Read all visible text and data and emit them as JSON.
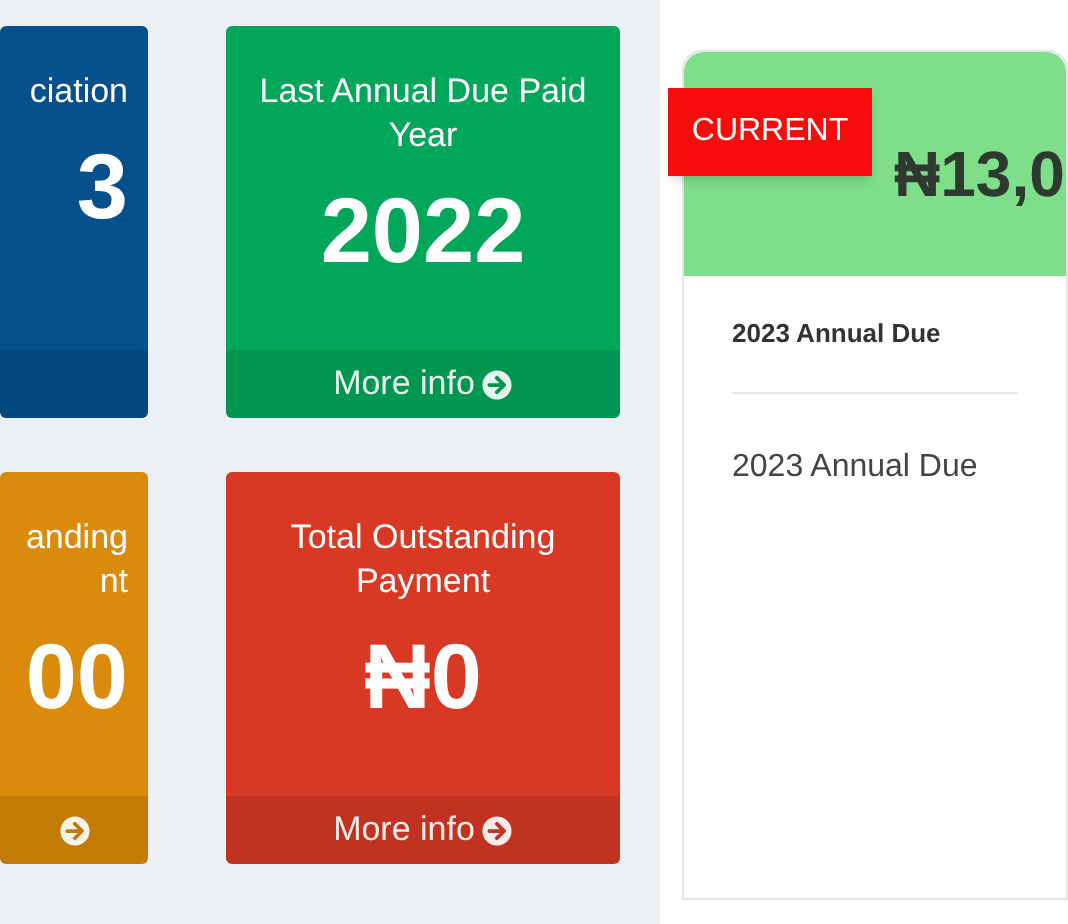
{
  "stat_cards": [
    {
      "kind": "partial",
      "title": "ciation",
      "value": "3",
      "footer_icon": false,
      "color": "#03508c"
    },
    {
      "kind": "full",
      "title": "Last Annual Due Paid Year",
      "value": "2022",
      "footer": "More info",
      "footer_icon": true,
      "color": "#00a65a"
    },
    {
      "kind": "partial",
      "title": "anding\nnt",
      "value": "00",
      "footer_icon": true,
      "color": "#db8b0b"
    },
    {
      "kind": "full",
      "title": "Total Outstanding Payment",
      "value": "₦0",
      "footer": "More info",
      "footer_icon": true,
      "color": "#d73925"
    }
  ],
  "due_card": {
    "ribbon": "CURRENT",
    "amount": "₦13,0",
    "heading": "2023 Annual Due",
    "item": "2023 Annual Due"
  }
}
